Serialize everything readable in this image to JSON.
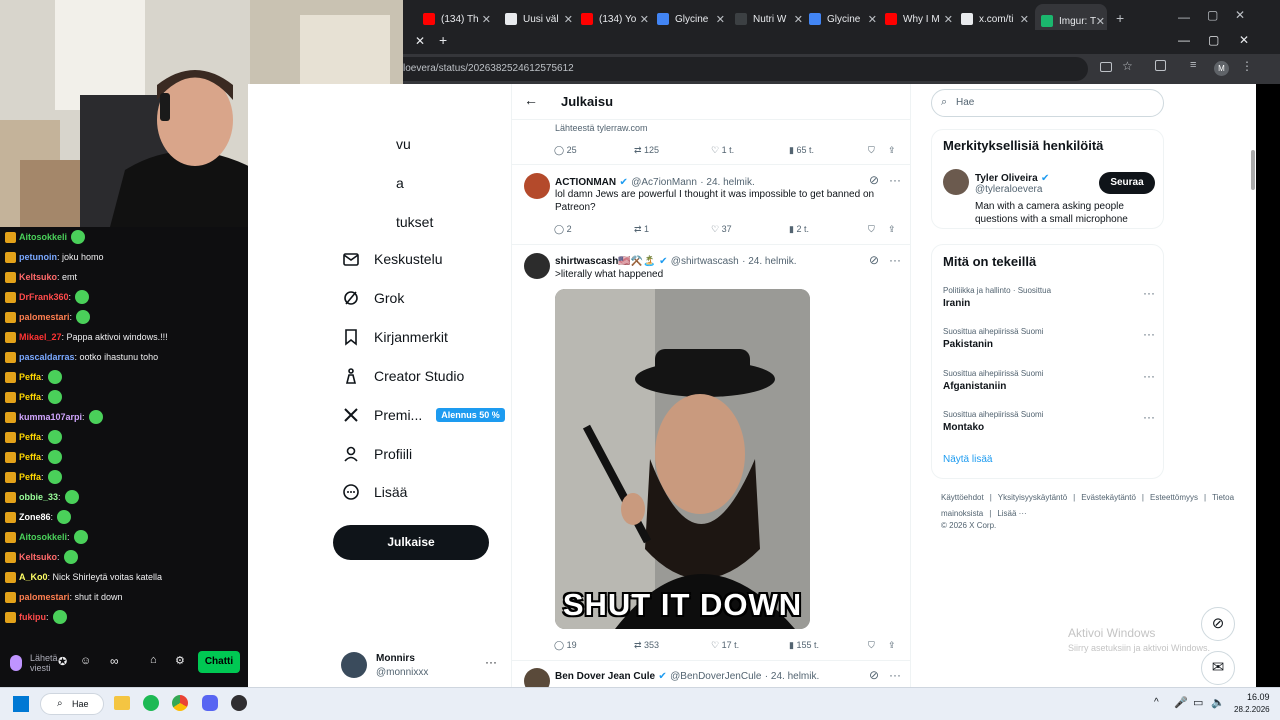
{
  "browser": {
    "tabs": [
      {
        "label": "(134) Th",
        "color": "#ff0000"
      },
      {
        "label": "Uusi väl",
        "color": "#e8eaed"
      },
      {
        "label": "(134) Yo",
        "color": "#ff0000"
      },
      {
        "label": "Glycine",
        "color": "#4285f4"
      },
      {
        "label": "Nutri W",
        "color": "#3c4043"
      },
      {
        "label": "Glycine",
        "color": "#4285f4"
      },
      {
        "label": "Why I M",
        "color": "#ff0000"
      },
      {
        "label": "x.com/ti",
        "color": "#e8eaed"
      },
      {
        "label": "Imgur: T",
        "color": "#1bb76e"
      }
    ],
    "url": "loevera/status/2026382524612575612",
    "profile_initial": "M"
  },
  "chat": {
    "messages": [
      {
        "user": "Aitosokkeli",
        "text": "",
        "color": "#4ad05a"
      },
      {
        "user": "petunoin",
        "text": ": joku homo",
        "color": "#7aa8ff"
      },
      {
        "user": "Keltsuko",
        "text": ": emt",
        "color": "#ff6a6a"
      },
      {
        "user": "DrFrank360",
        "text": ":",
        "color": "#ff4b4b"
      },
      {
        "user": "palomestari",
        "text": ":",
        "color": "#ff7f50"
      },
      {
        "user": "Mikael_27",
        "text": ": Pappa aktivoi windows.!!!",
        "color": "#ff3333"
      },
      {
        "user": "pascaldarras",
        "text": ": ootko ihastunu toho",
        "color": "#7aa8ff"
      },
      {
        "user": "Peffa",
        "text": ":",
        "color": "#ffd700"
      },
      {
        "user": "Peffa",
        "text": ":",
        "color": "#ffd700"
      },
      {
        "user": "kumma107arpi",
        "text": ":",
        "color": "#d2a6ff"
      },
      {
        "user": "Peffa",
        "text": ":",
        "color": "#ffd700"
      },
      {
        "user": "Peffa",
        "text": ":",
        "color": "#ffd700"
      },
      {
        "user": "Peffa",
        "text": ":",
        "color": "#ffd700"
      },
      {
        "user": "obbie_33",
        "text": ":",
        "color": "#9aff9a"
      },
      {
        "user": "Zone86",
        "text": ":",
        "color": "#ffffff"
      },
      {
        "user": "Aitosokkeli",
        "text": ":",
        "color": "#4ad05a"
      },
      {
        "user": "Keltsuko",
        "text": ":",
        "color": "#ff6a6a"
      },
      {
        "user": "A_Ko0",
        "text": ": Nick Shirleytä voitas katella",
        "color": "#ffff66"
      },
      {
        "user": "palomestari",
        "text": ": shut it down",
        "color": "#ff7f50"
      },
      {
        "user": "fukipu",
        "text": ":",
        "color": "#ff4b4b"
      }
    ],
    "input_placeholder": "Lähetä viesti",
    "chat_button": "Chatti"
  },
  "nav": {
    "items": [
      {
        "label": "vu"
      },
      {
        "label": "a"
      },
      {
        "label": "tukset"
      },
      {
        "label": "Keskustelu"
      },
      {
        "label": "Grok"
      },
      {
        "label": "Kirjanmerkit"
      },
      {
        "label": "Creator Studio"
      },
      {
        "label": "Premi..."
      },
      {
        "label": "Profiili"
      },
      {
        "label": "Lisää"
      }
    ],
    "premium_badge": "Alennus 50 %",
    "post_button": "Julkaise",
    "account_name": "Monnirs",
    "account_handle": "@monnixxx"
  },
  "post_header": {
    "title": "Julkaisu"
  },
  "posts": [
    {
      "source": "Lähteestä tylerraw.com",
      "replies": "25",
      "reposts": "125",
      "likes": "1 t.",
      "views": "65 t."
    },
    {
      "name": "ACTIONMAN",
      "handle": "@Ac7ionMann",
      "date": "· 24. helmik.",
      "text": "lol damn Jews are powerful I thought it was impossible to get banned on Patreon?",
      "replies": "2",
      "reposts": "1",
      "likes": "37",
      "views": "2 t."
    },
    {
      "name": "shirtwascash🇺🇸⚒️🏝️",
      "handle": "@shirtwascash",
      "date": "· 24. helmik.",
      "text": ">literally what happened",
      "image_caption": "SHUT IT DOWN",
      "replies": "19",
      "reposts": "353",
      "likes": "17 t.",
      "views": "155 t."
    },
    {
      "name": "Ben Dover Jean Cule",
      "handle": "@BenDoverJenCule",
      "date": "· 24. helmik."
    }
  ],
  "right": {
    "search_placeholder": "Hae",
    "who_title": "Merkityksellisiä henkilöitä",
    "person": {
      "name": "Tyler Oliveira",
      "handle": "@tyleraloevera",
      "bio": "Man with a camera asking people questions with a small microphone",
      "follow": "Seuraa"
    },
    "trends_title": "Mitä on tekeillä",
    "trends": [
      {
        "cat": "Politiikka ja hallinto · Suosittua",
        "name": "Iranin"
      },
      {
        "cat": "Suosittua aihepiirissä Suomi",
        "name": "Pakistanin"
      },
      {
        "cat": "Suosittua aihepiirissä Suomi",
        "name": "Afganistaniin"
      },
      {
        "cat": "Suosittua aihepiirissä Suomi",
        "name": "Montako"
      }
    ],
    "show_more": "Näytä lisää",
    "footer": [
      "Käyttöehdot",
      "|",
      "Yksityisyyskäytäntö",
      "|",
      "Evästekäytäntö",
      "|",
      "Esteettömyys",
      "|",
      "Tietoa mainoksista",
      "|",
      "Lisää ···"
    ],
    "copyright": "© 2026 X Corp.",
    "activate_title": "Aktivoi Windows",
    "activate_sub": "Siirry asetuksiin ja aktivoi Windows."
  },
  "taskbar": {
    "search": "Hae",
    "time": "16.09",
    "date": "28.2.2026"
  }
}
